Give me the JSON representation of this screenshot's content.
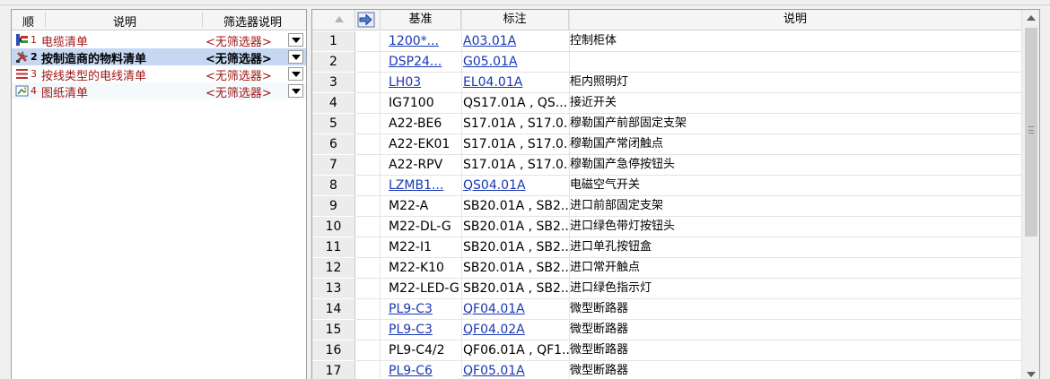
{
  "left_panel": {
    "headers": {
      "order": "顺",
      "description": "说明",
      "filter": "筛选器说明"
    },
    "rows": [
      {
        "num": "1",
        "label": "电缆清单",
        "filter": "<无筛选器>",
        "icon": "cable-list-icon",
        "selected": false
      },
      {
        "num": "2",
        "label": "按制造商的物料清单",
        "filter": "<无筛选器>",
        "icon": "tools-bom-icon",
        "selected": true
      },
      {
        "num": "3",
        "label": "按线类型的电线清单",
        "filter": "<无筛选器>",
        "icon": "wire-list-icon",
        "selected": false
      },
      {
        "num": "4",
        "label": "图纸清单",
        "filter": "<无筛选器>",
        "icon": "drawing-list-icon",
        "selected": false
      }
    ]
  },
  "grid": {
    "headers": {
      "base": "基准",
      "tag": "标注",
      "description": "说明"
    },
    "rows": [
      {
        "n": "1",
        "base": "1200*...",
        "tag": "A03.01A",
        "desc": "控制柜体",
        "link": true
      },
      {
        "n": "2",
        "base": "DSP24...",
        "tag": "G05.01A",
        "desc": "",
        "link": true
      },
      {
        "n": "3",
        "base": "LH03",
        "tag": "EL04.01A",
        "desc": "柜内照明灯",
        "link": true
      },
      {
        "n": "4",
        "base": "IG7100",
        "tag": "QS17.01A , QS...",
        "desc": "接近开关",
        "link": false
      },
      {
        "n": "5",
        "base": "A22-BE6",
        "tag": "S17.01A , S17.0...",
        "desc": "穆勒国产前部固定支架",
        "link": false
      },
      {
        "n": "6",
        "base": "A22-EK01",
        "tag": "S17.01A , S17.0...",
        "desc": "穆勒国产常闭触点",
        "link": false
      },
      {
        "n": "7",
        "base": "A22-RPV",
        "tag": "S17.01A , S17.0...",
        "desc": "穆勒国产急停按钮头",
        "link": false
      },
      {
        "n": "8",
        "base": "LZMB1...",
        "tag": "QS04.01A",
        "desc": "电磁空气开关",
        "link": true
      },
      {
        "n": "9",
        "base": "M22-A",
        "tag": "SB20.01A , SB2...",
        "desc": "进口前部固定支架",
        "link": false
      },
      {
        "n": "10",
        "base": "M22-DL-G",
        "tag": "SB20.01A , SB2...",
        "desc": "进口绿色带灯按钮头",
        "link": false
      },
      {
        "n": "11",
        "base": "M22-I1",
        "tag": "SB20.01A , SB2...",
        "desc": "进口单孔按钮盒",
        "link": false
      },
      {
        "n": "12",
        "base": "M22-K10",
        "tag": "SB20.01A , SB2...",
        "desc": "进口常开触点",
        "link": false
      },
      {
        "n": "13",
        "base": "M22-LED-G",
        "tag": "SB20.01A , SB2...",
        "desc": "进口绿色指示灯",
        "link": false
      },
      {
        "n": "14",
        "base": "PL9-C3",
        "tag": "QF04.01A",
        "desc": "微型断路器",
        "link": true
      },
      {
        "n": "15",
        "base": "PL9-C3",
        "tag": "QF04.02A",
        "desc": "微型断路器",
        "link": true
      },
      {
        "n": "16",
        "base": "PL9-C4/2",
        "tag": "QF06.01A , QF1...",
        "desc": "微型断路器",
        "link": false
      },
      {
        "n": "17",
        "base": "PL9-C6",
        "tag": "QF05.01A",
        "desc": "微型断路器",
        "link": true
      }
    ]
  },
  "colors": {
    "link": "#1a37b4",
    "left_text": "#a01818",
    "selection": "#c5d7f2"
  }
}
